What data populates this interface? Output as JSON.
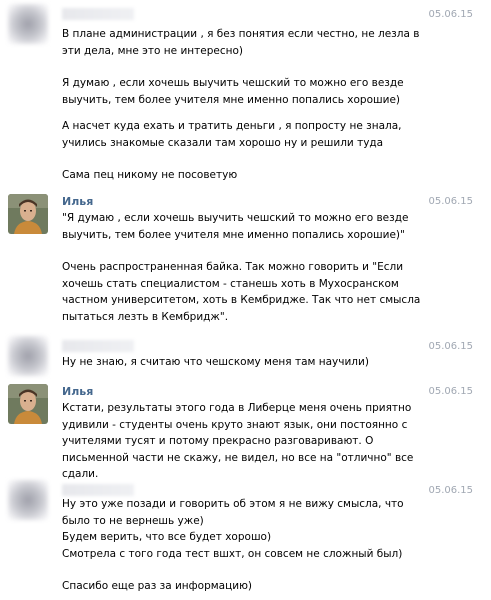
{
  "messages": [
    {
      "author": "",
      "author_blurred": true,
      "date": "05.06.15",
      "paragraphs": [
        "В плане администрации , я без понятия если честно, не лезла в эти дела, мне это не интересно)",
        "Я думаю , если хочешь выучить чешский то можно его везде выучить, тем более учителя мне именно попались хорошие)",
        "А насчет куда ехать и тратить деньги , я попросту не знала, учились знакомые сказали там хорошо ну и решили туда",
        "Сама пец никому не посоветую"
      ]
    },
    {
      "author": "Илья",
      "author_blurred": false,
      "date": "05.06.15",
      "paragraphs": [
        "\"Я думаю , если хочешь выучить чешский то можно его везде выучить, тем более учителя мне именно попались хорошие)\"",
        "Очень распространенная байка. Так можно говорить и \"Если хочешь стать специалистом - станешь хоть в Мухосранском частном университетом, хоть в Кембридже. Так что нет смысла пытаться лезть в Кембридж\"."
      ]
    },
    {
      "author": "",
      "author_blurred": true,
      "date": "05.06.15",
      "paragraphs": [
        "Ну не знаю, я считаю что чешскому меня там научили)"
      ]
    },
    {
      "author": "Илья",
      "author_blurred": false,
      "date": "05.06.15",
      "paragraphs": [
        "Кстати, результаты этого года в Либерце меня очень приятно удивили - студенты очень круто знают язык, они постоянно с учителями тусят и потому прекрасно разговаривают. О письменной части не скажу, не видел, но все на \"отлично\" все сдали."
      ]
    },
    {
      "author": "",
      "author_blurred": true,
      "date": "05.06.15",
      "paragraphs": [
        "Ну это уже позади и говорить об этом я не вижу смысла, что было то не вернешь уже)\nБудем верить, что все будет хорошо)\nСмотрела с того года тест вшхт, он совсем не сложный был)",
        "Спасибо еще раз за информацию)"
      ]
    }
  ]
}
